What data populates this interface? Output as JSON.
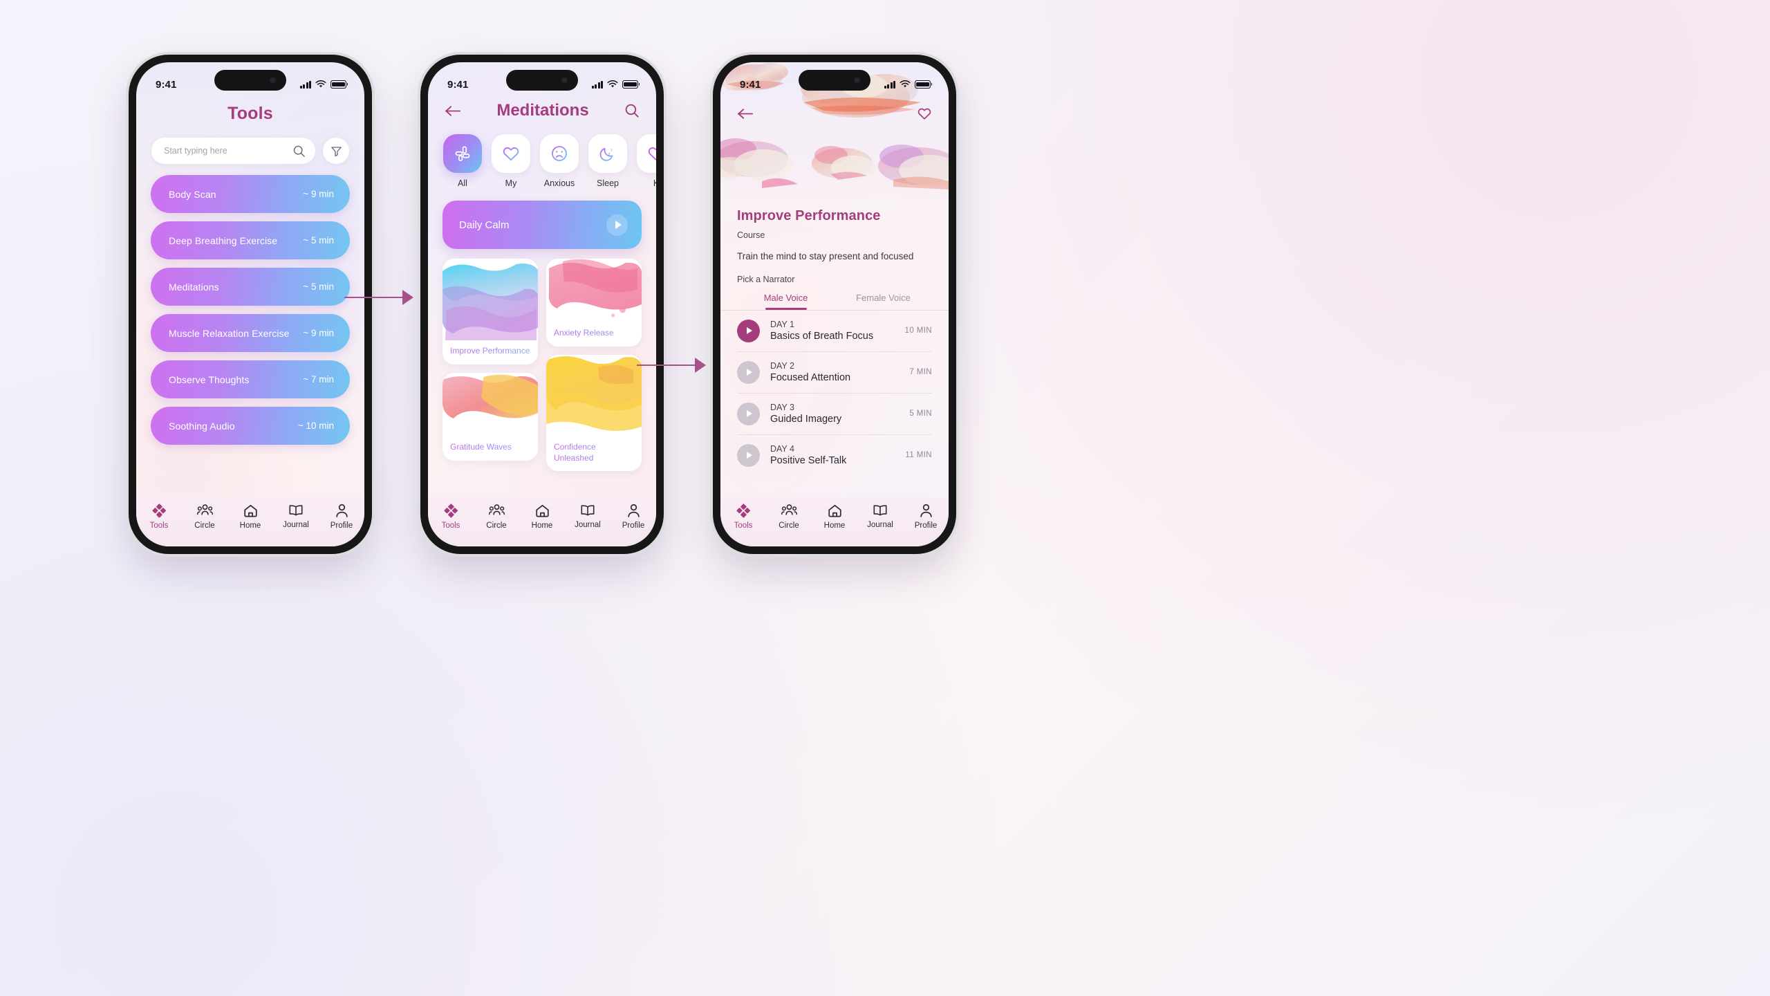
{
  "status": {
    "time": "9:41"
  },
  "screen1": {
    "title": "Tools",
    "search": {
      "placeholder": "Start typing here",
      "value": ""
    },
    "tools": [
      {
        "name": "Body Scan",
        "duration": "~ 9 min"
      },
      {
        "name": "Deep Breathing Exercise",
        "duration": "~ 5 min"
      },
      {
        "name": "Meditations",
        "duration": "~ 5 min"
      },
      {
        "name": "Muscle Relaxation Exercise",
        "duration": "~ 9 min"
      },
      {
        "name": "Observe Thoughts",
        "duration": "~ 7 min"
      },
      {
        "name": "Soothing Audio",
        "duration": "~ 10 min"
      }
    ]
  },
  "screen2": {
    "title": "Meditations",
    "categories": [
      {
        "label": "All",
        "icon": "grid-icon",
        "active": true
      },
      {
        "label": "My",
        "icon": "heart-icon",
        "active": false
      },
      {
        "label": "Anxious",
        "icon": "sad-face-icon",
        "active": false
      },
      {
        "label": "Sleep",
        "icon": "moon-zzz-icon",
        "active": false
      },
      {
        "label": "K",
        "icon": "partial-icon",
        "active": false
      }
    ],
    "featured": {
      "label": "Daily Calm"
    },
    "cards": [
      {
        "label": "Improve Performance",
        "art": "blue-purple-watercolor",
        "tall": true
      },
      {
        "label": "Anxiety Release",
        "art": "pink-watercolor",
        "tall": false
      },
      {
        "label": "Gratitude Waves",
        "art": "coral-watercolor",
        "tall": false
      },
      {
        "label": "Confidence Unleashed",
        "art": "yellow-watercolor",
        "tall": true
      }
    ]
  },
  "screen3": {
    "title": "Improve Performance",
    "kind": "Course",
    "description": "Train the mind to stay present and focused",
    "narrator_label": "Pick a Narrator",
    "voice_tabs": [
      {
        "label": "Male Voice",
        "active": true
      },
      {
        "label": "Female Voice",
        "active": false
      }
    ],
    "days": [
      {
        "day": "DAY 1",
        "title": "Basics of Breath Focus",
        "minutes": "10 MIN",
        "active": true
      },
      {
        "day": "DAY 2",
        "title": "Focused Attention",
        "minutes": "7 MIN",
        "active": false
      },
      {
        "day": "DAY 3",
        "title": "Guided Imagery",
        "minutes": "5 MIN",
        "active": false
      },
      {
        "day": "DAY 4",
        "title": "Positive Self-Talk",
        "minutes": "11 MIN",
        "active": false
      }
    ]
  },
  "tabbar": {
    "items": [
      {
        "label": "Tools",
        "icon": "diamonds-icon",
        "active": true
      },
      {
        "label": "Circle",
        "icon": "people-icon",
        "active": false
      },
      {
        "label": "Home",
        "icon": "house-icon",
        "active": false
      },
      {
        "label": "Journal",
        "icon": "book-icon",
        "active": false
      },
      {
        "label": "Profile",
        "icon": "person-icon",
        "active": false
      }
    ]
  },
  "colors": {
    "accent": "#a53c7c",
    "gradient_start": "#cf6ef0",
    "gradient_end": "#6cc6f2",
    "arrow": "#a8508a"
  }
}
